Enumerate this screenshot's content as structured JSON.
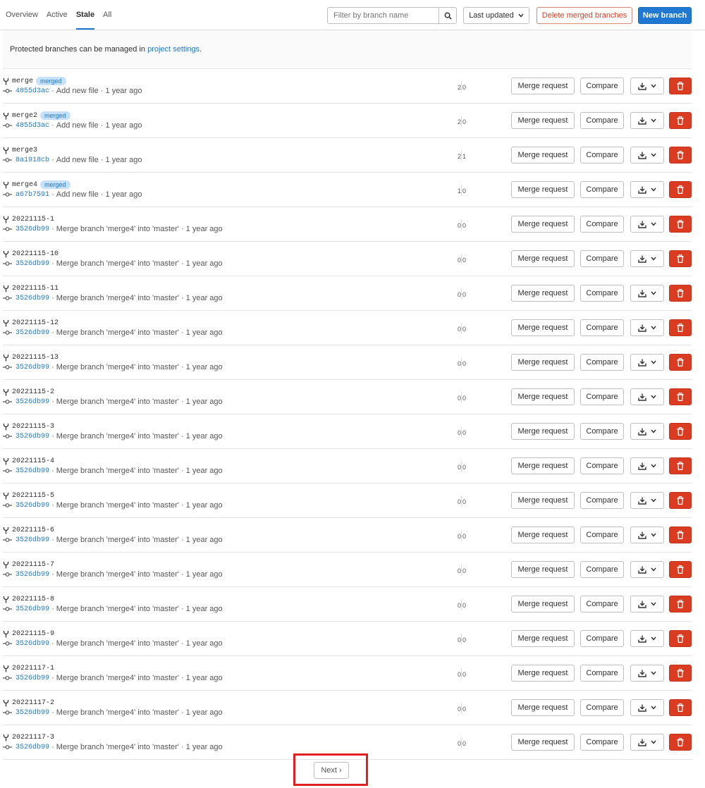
{
  "tabs": [
    {
      "label": "Overview"
    },
    {
      "label": "Active"
    },
    {
      "label": "Stale"
    },
    {
      "label": "All"
    }
  ],
  "active_tab": "Stale",
  "filter": {
    "placeholder": "Filter by branch name",
    "icon": "search-icon"
  },
  "sort_label": "Last updated",
  "delete_merged_label": "Delete merged branches",
  "new_branch_label": "New branch",
  "info": {
    "text": "Protected branches can be managed in ",
    "link": "project settings",
    "suffix": "."
  },
  "row_buttons": {
    "merge_request": "Merge request",
    "compare": "Compare"
  },
  "branches": [
    {
      "name": "merge",
      "merged": true,
      "badge": "merged",
      "sha": "4855d3ac",
      "message": "Add new file",
      "time": "1 year ago",
      "behind": "2",
      "ahead": "0"
    },
    {
      "name": "merge2",
      "merged": true,
      "badge": "merged",
      "sha": "4855d3ac",
      "message": "Add new file",
      "time": "1 year ago",
      "behind": "2",
      "ahead": "0"
    },
    {
      "name": "merge3",
      "merged": false,
      "badge": "",
      "sha": "8a1918cb",
      "message": "Add new file",
      "time": "1 year ago",
      "behind": "2",
      "ahead": "1"
    },
    {
      "name": "merge4",
      "merged": true,
      "badge": "merged",
      "sha": "a67b7591",
      "message": "Add new file",
      "time": "1 year ago",
      "behind": "1",
      "ahead": "0"
    },
    {
      "name": "20221115-1",
      "merged": false,
      "badge": "",
      "sha": "3526db99",
      "message": "Merge branch 'merge4' into 'master'",
      "time": "1 year ago",
      "behind": "0",
      "ahead": "0"
    },
    {
      "name": "20221115-10",
      "merged": false,
      "badge": "",
      "sha": "3526db99",
      "message": "Merge branch 'merge4' into 'master'",
      "time": "1 year ago",
      "behind": "0",
      "ahead": "0"
    },
    {
      "name": "20221115-11",
      "merged": false,
      "badge": "",
      "sha": "3526db99",
      "message": "Merge branch 'merge4' into 'master'",
      "time": "1 year ago",
      "behind": "0",
      "ahead": "0"
    },
    {
      "name": "20221115-12",
      "merged": false,
      "badge": "",
      "sha": "3526db99",
      "message": "Merge branch 'merge4' into 'master'",
      "time": "1 year ago",
      "behind": "0",
      "ahead": "0"
    },
    {
      "name": "20221115-13",
      "merged": false,
      "badge": "",
      "sha": "3526db99",
      "message": "Merge branch 'merge4' into 'master'",
      "time": "1 year ago",
      "behind": "0",
      "ahead": "0"
    },
    {
      "name": "20221115-2",
      "merged": false,
      "badge": "",
      "sha": "3526db99",
      "message": "Merge branch 'merge4' into 'master'",
      "time": "1 year ago",
      "behind": "0",
      "ahead": "0"
    },
    {
      "name": "20221115-3",
      "merged": false,
      "badge": "",
      "sha": "3526db99",
      "message": "Merge branch 'merge4' into 'master'",
      "time": "1 year ago",
      "behind": "0",
      "ahead": "0"
    },
    {
      "name": "20221115-4",
      "merged": false,
      "badge": "",
      "sha": "3526db99",
      "message": "Merge branch 'merge4' into 'master'",
      "time": "1 year ago",
      "behind": "0",
      "ahead": "0"
    },
    {
      "name": "20221115-5",
      "merged": false,
      "badge": "",
      "sha": "3526db99",
      "message": "Merge branch 'merge4' into 'master'",
      "time": "1 year ago",
      "behind": "0",
      "ahead": "0"
    },
    {
      "name": "20221115-6",
      "merged": false,
      "badge": "",
      "sha": "3526db99",
      "message": "Merge branch 'merge4' into 'master'",
      "time": "1 year ago",
      "behind": "0",
      "ahead": "0"
    },
    {
      "name": "20221115-7",
      "merged": false,
      "badge": "",
      "sha": "3526db99",
      "message": "Merge branch 'merge4' into 'master'",
      "time": "1 year ago",
      "behind": "0",
      "ahead": "0"
    },
    {
      "name": "20221115-8",
      "merged": false,
      "badge": "",
      "sha": "3526db99",
      "message": "Merge branch 'merge4' into 'master'",
      "time": "1 year ago",
      "behind": "0",
      "ahead": "0"
    },
    {
      "name": "20221115-9",
      "merged": false,
      "badge": "",
      "sha": "3526db99",
      "message": "Merge branch 'merge4' into 'master'",
      "time": "1 year ago",
      "behind": "0",
      "ahead": "0"
    },
    {
      "name": "20221117-1",
      "merged": false,
      "badge": "",
      "sha": "3526db99",
      "message": "Merge branch 'merge4' into 'master'",
      "time": "1 year ago",
      "behind": "0",
      "ahead": "0"
    },
    {
      "name": "20221117-2",
      "merged": false,
      "badge": "",
      "sha": "3526db99",
      "message": "Merge branch 'merge4' into 'master'",
      "time": "1 year ago",
      "behind": "0",
      "ahead": "0"
    },
    {
      "name": "20221117-3",
      "merged": false,
      "badge": "",
      "sha": "3526db99",
      "message": "Merge branch 'merge4' into 'master'",
      "time": "1 year ago",
      "behind": "0",
      "ahead": "0"
    }
  ],
  "pagination": {
    "next_label": "Next ›"
  },
  "colors": {
    "accent": "#1f78d1",
    "danger": "#db3b21",
    "highlight_box": "#e02020",
    "badge_bg": "#c7e1fb"
  }
}
